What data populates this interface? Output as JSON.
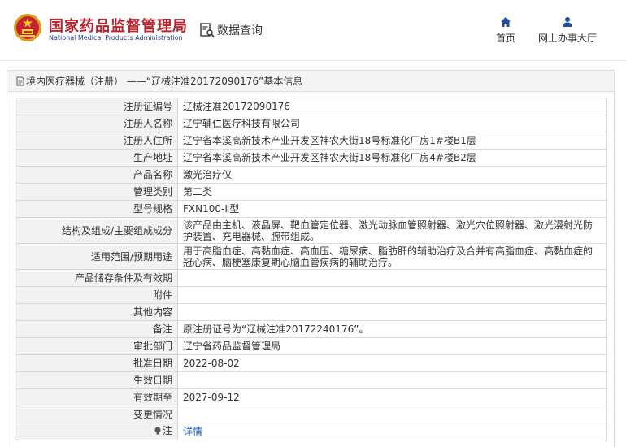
{
  "header": {
    "brand_cn": "国家药品监督管理局",
    "brand_en": "National Medical Products Administration",
    "data_query": "数据查询",
    "nav": {
      "home": "首页",
      "hall": "网上办事大厅"
    }
  },
  "panel": {
    "title": "境内医疗器械（注册） ——“辽械注准20172090176”基本信息"
  },
  "rows": [
    {
      "label": "注册证编号",
      "value": "辽械注准20172090176"
    },
    {
      "label": "注册人名称",
      "value": "辽宁辅仁医疗科技有限公司"
    },
    {
      "label": "注册人住所",
      "value": "辽宁省本溪高新技术产业开发区神农大街18号标准化厂房1#楼B1层"
    },
    {
      "label": "生产地址",
      "value": "辽宁省本溪高新技术产业开发区神农大街18号标准化厂房4#楼B2层"
    },
    {
      "label": "产品名称",
      "value": "激光治疗仪"
    },
    {
      "label": "管理类别",
      "value": "第二类"
    },
    {
      "label": "型号规格",
      "value": "FXN100-Ⅱ型"
    },
    {
      "label": "结构及组成/主要组成成分",
      "value": "该产品由主机、液晶屏、靶血管定位器、激光动脉血管照射器、激光穴位照射器、激光漫射光防护装置、充电器械、腕带组成。"
    },
    {
      "label": "适用范围/预期用途",
      "value": "用于高脂血症、高黏血症、高血压、糖尿病、脂肪肝的辅助治疗及合并有高脂血症、高黏血症的冠心病、脑梗塞康复期心脑血管疾病的辅助治疗。"
    },
    {
      "label": "产品储存条件及有效期",
      "value": ""
    },
    {
      "label": "附件",
      "value": ""
    },
    {
      "label": "其他内容",
      "value": ""
    },
    {
      "label": "备注",
      "value": "原注册证号为“辽械注准20172240176”。"
    },
    {
      "label": "审批部门",
      "value": "辽宁省药品监督管理局"
    },
    {
      "label": "批准日期",
      "value": "2022-08-02"
    },
    {
      "label": "生效日期",
      "value": ""
    },
    {
      "label": "有效期至",
      "value": "2027-09-12"
    },
    {
      "label": "变更情况",
      "value": ""
    }
  ],
  "note": {
    "label": "注",
    "link": "详情"
  },
  "colors": {
    "brand_red": "#b8232d",
    "brand_blue": "#1d3c8c",
    "link_blue": "#1a62c8"
  }
}
